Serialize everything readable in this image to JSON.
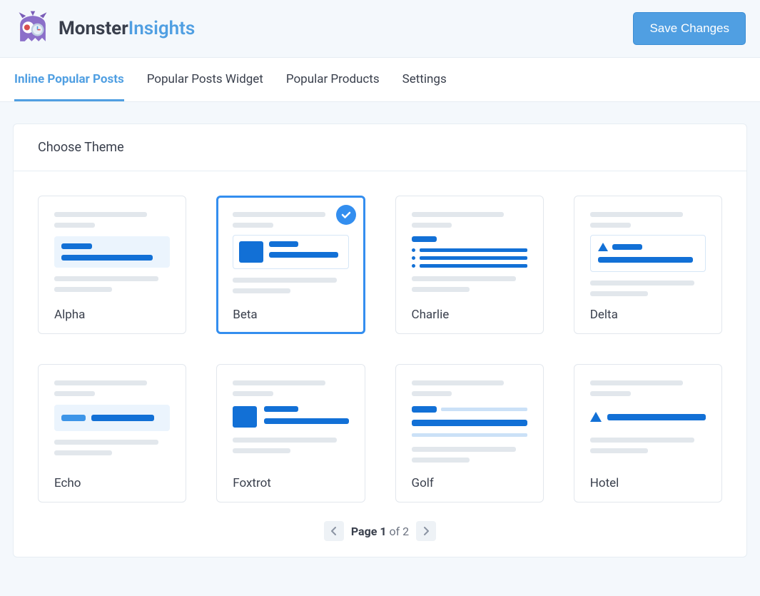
{
  "header": {
    "brand_part1": "Monster",
    "brand_part2": "Insights",
    "save_button": "Save Changes"
  },
  "tabs": [
    {
      "label": "Inline Popular Posts",
      "active": true
    },
    {
      "label": "Popular Posts Widget",
      "active": false
    },
    {
      "label": "Popular Products",
      "active": false
    },
    {
      "label": "Settings",
      "active": false
    }
  ],
  "panel": {
    "title": "Choose Theme"
  },
  "themes": [
    {
      "name": "Alpha",
      "selected": false
    },
    {
      "name": "Beta",
      "selected": true
    },
    {
      "name": "Charlie",
      "selected": false
    },
    {
      "name": "Delta",
      "selected": false
    },
    {
      "name": "Echo",
      "selected": false
    },
    {
      "name": "Foxtrot",
      "selected": false
    },
    {
      "name": "Golf",
      "selected": false
    },
    {
      "name": "Hotel",
      "selected": false
    }
  ],
  "pagination": {
    "prefix": "Page",
    "current": "1",
    "of_text": "of",
    "total": "2"
  }
}
